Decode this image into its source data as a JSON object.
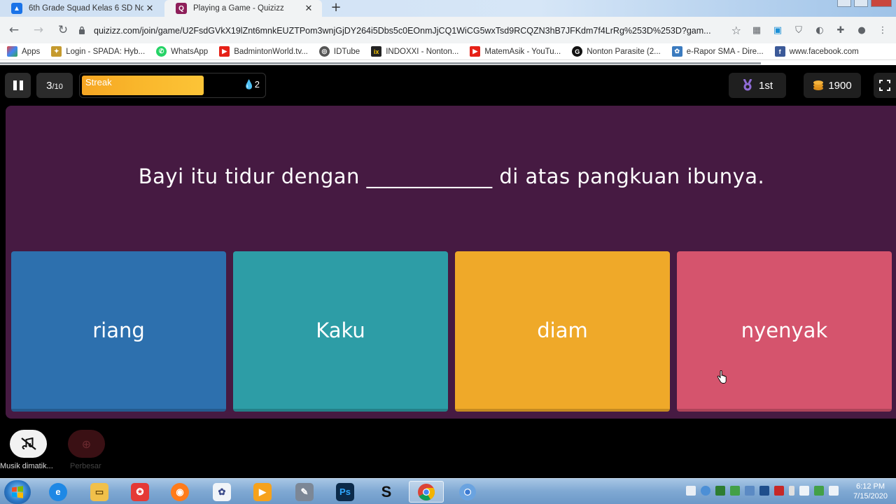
{
  "browser": {
    "tabs": [
      {
        "title": "6th Grade Squad Kelas 6 SD No",
        "close": "✕",
        "icon": "google-classroom-icon"
      },
      {
        "title": "Playing a Game - Quizizz",
        "close": "✕",
        "icon": "quizizz-icon"
      }
    ],
    "new_tab": "+",
    "url": "quizizz.com/join/game/U2FsdGVkX19lZnt6mnkEUZTPom3wnjGjDY264i5Dbs5c0EOnmJjCQ1WiCG5wxTsd9RCQZN3hB7JFKdm7f4LrRg%253D%253D?gam...",
    "bookmarks": [
      {
        "label": "Apps",
        "icon": "apps-grid-icon",
        "color": "#e8453c"
      },
      {
        "label": "Login - SPADA: Hyb...",
        "icon": "spada-icon",
        "color": "#c59a2e"
      },
      {
        "label": "WhatsApp",
        "icon": "whatsapp-icon",
        "color": "#25d366"
      },
      {
        "label": "BadmintonWorld.tv...",
        "icon": "youtube-icon",
        "color": "#e62117"
      },
      {
        "label": "IDTube",
        "icon": "idtube-icon",
        "color": "#555555"
      },
      {
        "label": "INDOXXI - Nonton...",
        "icon": "indoxxi-icon",
        "color": "#222222"
      },
      {
        "label": "MatemAsik - YouTu...",
        "icon": "youtube-icon",
        "color": "#e62117"
      },
      {
        "label": "Nonton Parasite (2...",
        "icon": "parasite-icon",
        "color": "#111111"
      },
      {
        "label": "e-Rapor SMA - Dire...",
        "icon": "erapor-icon",
        "color": "#3b7bbf"
      },
      {
        "label": "www.facebook.com",
        "icon": "facebook-icon",
        "color": "#3b5998"
      }
    ]
  },
  "game": {
    "question_number": "3",
    "question_total": "/10",
    "streak_label": "Streak",
    "streak_count": "2",
    "streak_fill": 0.66,
    "rank": "1st",
    "coins": "1900",
    "question": "Bayi itu tidur dengan ____________ di atas pangkuan ibunya.",
    "options": [
      {
        "text": "riang",
        "color": "#2d70ae"
      },
      {
        "text": "Kaku",
        "color": "#2d9da6"
      },
      {
        "text": "diam",
        "color": "#efa929"
      },
      {
        "text": "nyenyak",
        "color": "#d5546d"
      }
    ],
    "music_label": "Musik dimatik...",
    "zoom_label": "Perbesar"
  },
  "taskbar": {
    "apps": [
      "start-orb-icon",
      "internet-explorer-icon",
      "file-explorer-icon",
      "app-icon",
      "firefox-icon",
      "unity-icon",
      "media-player-icon",
      "tools-icon",
      "photoshop-icon",
      "s-app-icon",
      "chrome-icon",
      "chrome-alt-icon"
    ],
    "time": "6:12 PM",
    "date": "7/15/2020"
  }
}
